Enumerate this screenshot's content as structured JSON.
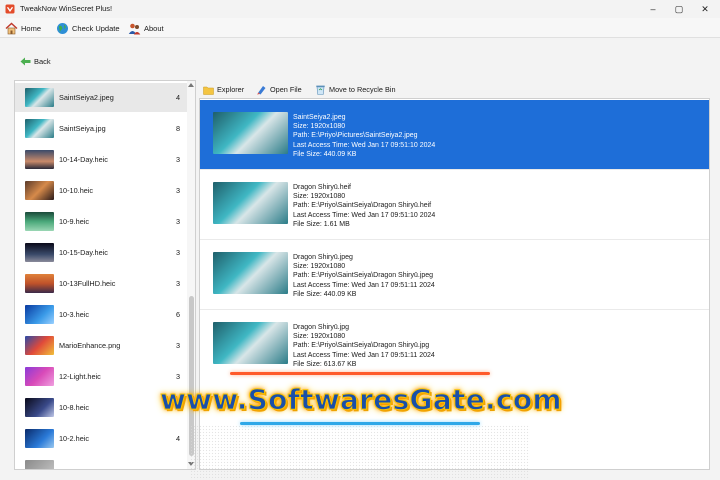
{
  "window": {
    "title": "TweakNow WinSecret Plus!",
    "minimize_glyph": "–",
    "maximize_glyph": "▢",
    "close_glyph": "✕"
  },
  "menu": {
    "home": "Home",
    "check_update": "Check Update",
    "about": "About"
  },
  "nav": {
    "back": "Back"
  },
  "toolbar": {
    "explorer": "Explorer",
    "open_file": "Open File",
    "recycle": "Move to Recycle Bin"
  },
  "files": [
    {
      "name": "SaintSeiya2.jpeg",
      "count": "4",
      "thumb": "anime"
    },
    {
      "name": "SaintSeiya.jpg",
      "count": "8",
      "thumb": "anime"
    },
    {
      "name": "10-14-Day.heic",
      "count": "3",
      "thumb": "dusk"
    },
    {
      "name": "10-10.heic",
      "count": "3",
      "thumb": "rock"
    },
    {
      "name": "10-9.heic",
      "count": "3",
      "thumb": "green"
    },
    {
      "name": "10-15-Day.heic",
      "count": "3",
      "thumb": "night"
    },
    {
      "name": "10-13FullHD.heic",
      "count": "3",
      "thumb": "sunset"
    },
    {
      "name": "10-3.heic",
      "count": "6",
      "thumb": "blue"
    },
    {
      "name": "MarioEnhance.png",
      "count": "3",
      "thumb": "mario"
    },
    {
      "name": "12-Light.heic",
      "count": "3",
      "thumb": "purple"
    },
    {
      "name": "10-8.heic",
      "count": "3",
      "thumb": "space"
    },
    {
      "name": "10-2.heic",
      "count": "4",
      "thumb": "wave"
    },
    {
      "name": "",
      "count": "",
      "thumb": "grey"
    }
  ],
  "details": [
    {
      "name": "SaintSeiya2.jpeg",
      "size": "Size: 1920x1080",
      "path": "Path: E:\\Priyo\\Pictures\\SaintSeiya2.jpeg",
      "access": "Last Access Time: Wed Jan 17 09:51:10 2024",
      "filesize": "File Size: 440.09 KB",
      "selected": true
    },
    {
      "name": "Dragon Shiryū.heif",
      "size": "Size: 1920x1080",
      "path": "Path: E:\\Priyo\\SaintSeiya\\Dragon Shiryū.heif",
      "access": "Last Access Time: Wed Jan 17 09:51:10 2024",
      "filesize": "File Size: 1.61 MB",
      "selected": false
    },
    {
      "name": "Dragon Shiryū.jpeg",
      "size": "Size: 1920x1080",
      "path": "Path: E:\\Priyo\\SaintSeiya\\Dragon Shiryū.jpeg",
      "access": "Last Access Time: Wed Jan 17 09:51:11 2024",
      "filesize": "File Size: 440.09 KB",
      "selected": false
    },
    {
      "name": "Dragon Shiryū.jpg",
      "size": "Size: 1920x1080",
      "path": "Path: E:\\Priyo\\SaintSeiya\\Dragon Shiryū.jpg",
      "access": "Last Access Time: Wed Jan 17 09:51:11 2024",
      "filesize": "File Size: 613.67 KB",
      "selected": false
    }
  ],
  "watermark": {
    "text": "www.SoftwaresGate.com"
  },
  "colors": {
    "selection": "#1e6ed8",
    "list_selection": "#e8e8e8",
    "window_bg": "#f3f3f3"
  }
}
